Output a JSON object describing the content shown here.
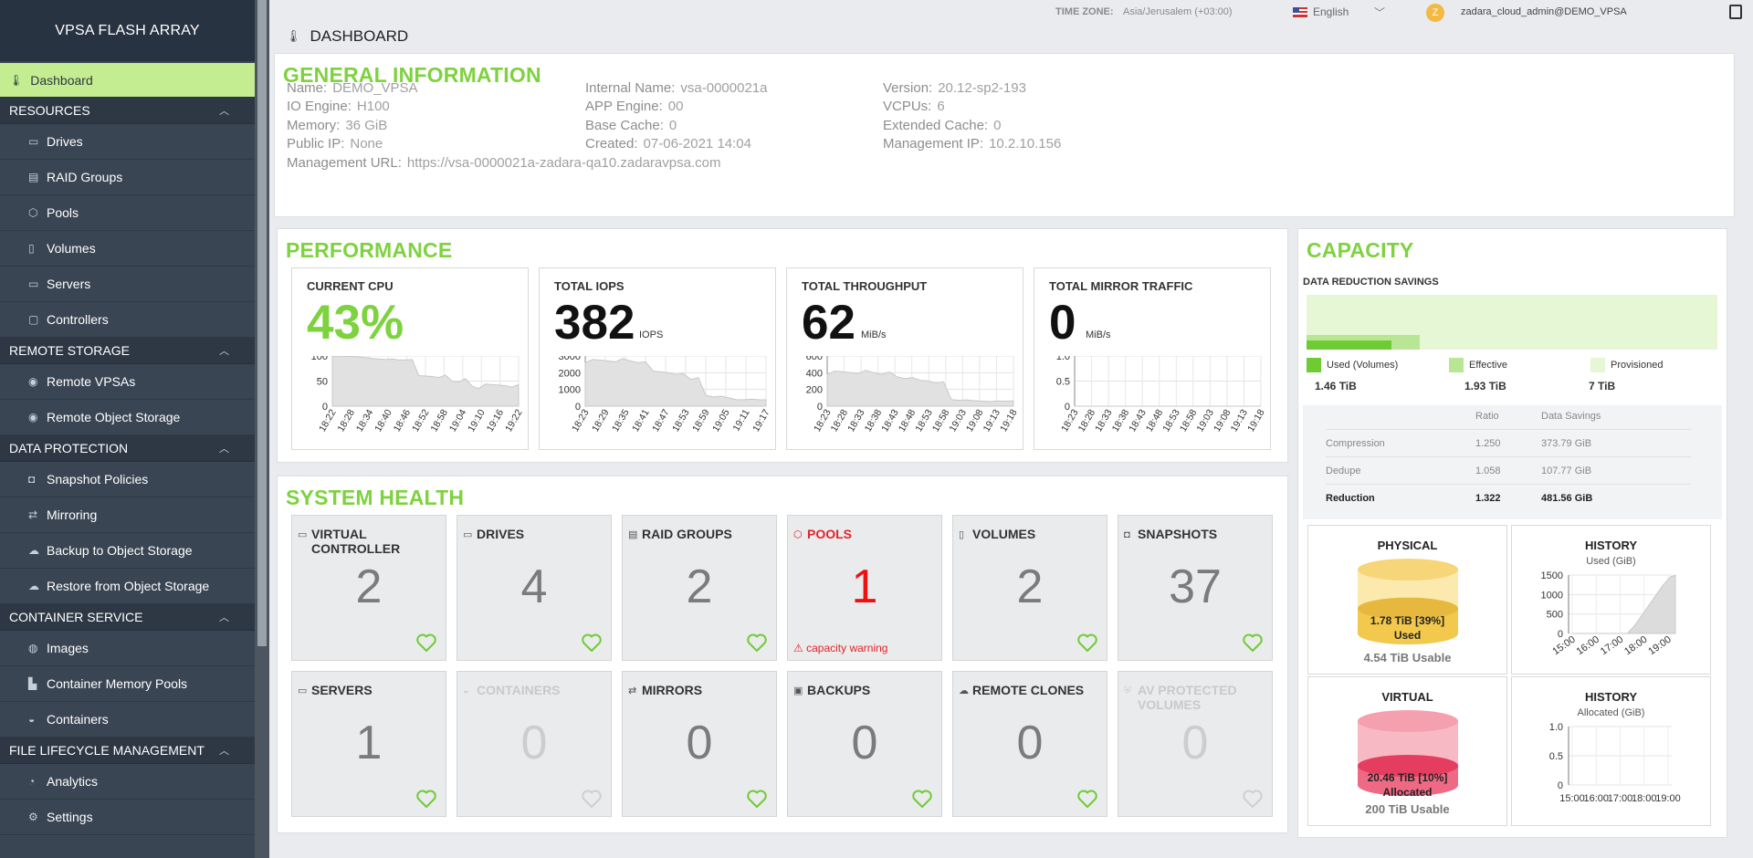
{
  "sidebar": {
    "title": "VPSA FLASH ARRAY",
    "dashboard": "Dashboard",
    "sections": [
      {
        "title": "RESOURCES",
        "items": [
          "Drives",
          "RAID Groups",
          "Pools",
          "Volumes",
          "Servers",
          "Controllers"
        ]
      },
      {
        "title": "REMOTE STORAGE",
        "items": [
          "Remote VPSAs",
          "Remote Object Storage"
        ]
      },
      {
        "title": "DATA PROTECTION",
        "items": [
          "Snapshot Policies",
          "Mirroring",
          "Backup to Object Storage",
          "Restore from Object Storage"
        ]
      },
      {
        "title": "CONTAINER SERVICE",
        "items": [
          "Images",
          "Container Memory Pools",
          "Containers"
        ]
      },
      {
        "title": "FILE LIFECYCLE MANAGEMENT",
        "items": [
          "Analytics",
          "Settings"
        ]
      }
    ]
  },
  "header": {
    "tz_label": "TIME ZONE:",
    "tz_value": "Asia/Jerusalem (+03:00)",
    "language": "English",
    "avatar_letter": "Z",
    "user": "zadara_cloud_admin@DEMO_VPSA",
    "page_title": "DASHBOARD"
  },
  "general": {
    "title": "GENERAL INFORMATION",
    "fields": [
      {
        "k": "Name:",
        "v": "DEMO_VPSA"
      },
      {
        "k": "Internal Name:",
        "v": "vsa-0000021a"
      },
      {
        "k": "Version:",
        "v": "20.12-sp2-193"
      },
      {
        "k": "IO Engine:",
        "v": "H100"
      },
      {
        "k": "APP Engine:",
        "v": "00"
      },
      {
        "k": "VCPUs:",
        "v": "6"
      },
      {
        "k": "Memory:",
        "v": "36 GiB"
      },
      {
        "k": "Base Cache:",
        "v": "0"
      },
      {
        "k": "Extended Cache:",
        "v": "0"
      },
      {
        "k": "Public IP:",
        "v": "None"
      },
      {
        "k": "Created:",
        "v": "07-06-2021 14:04"
      },
      {
        "k": "Management IP:",
        "v": "10.2.10.156"
      },
      {
        "k": "Management URL:",
        "v": "https://vsa-0000021a-zadara-qa10.zadaravpsa.com"
      }
    ]
  },
  "performance": {
    "title": "PERFORMANCE",
    "cards": [
      {
        "label": "CURRENT CPU",
        "value": "43%",
        "unit": "",
        "yticks": [
          "100",
          "50",
          "0"
        ],
        "ymax": 100,
        "xticks": [
          "18:22",
          "18:28",
          "18:34",
          "18:40",
          "18:46",
          "18:52",
          "18:58",
          "19:04",
          "19:10",
          "19:16",
          "19:22"
        ],
        "series": [
          99,
          100,
          99,
          99,
          98,
          97,
          95,
          94,
          93,
          94,
          92,
          92,
          93,
          61,
          60,
          59,
          57,
          62,
          50,
          48,
          55,
          40,
          35,
          44,
          43,
          42,
          41,
          38,
          43
        ]
      },
      {
        "label": "TOTAL IOPS",
        "value": "382",
        "unit": "IOPS",
        "yticks": [
          "3000",
          "2000",
          "1000",
          "0"
        ],
        "ymax": 3000,
        "xticks": [
          "18:23",
          "18:29",
          "18:35",
          "18:41",
          "18:47",
          "18:53",
          "18:59",
          "19:05",
          "19:11",
          "19:17"
        ],
        "series": [
          2600,
          2800,
          2750,
          2700,
          2650,
          2850,
          2700,
          2600,
          2650,
          2100,
          2050,
          2000,
          1900,
          1950,
          1600,
          1700,
          650,
          550,
          600,
          500,
          400,
          380,
          420,
          390,
          382
        ]
      },
      {
        "label": "TOTAL THROUGHPUT",
        "value": "62",
        "unit": "MiB/s",
        "yticks": [
          "600",
          "400",
          "200",
          "0"
        ],
        "ymax": 600,
        "xticks": [
          "18:23",
          "18:28",
          "18:33",
          "18:38",
          "18:43",
          "18:48",
          "18:53",
          "18:58",
          "19:03",
          "19:08",
          "19:13",
          "19:18"
        ],
        "series": [
          380,
          420,
          410,
          400,
          390,
          430,
          400,
          380,
          410,
          350,
          330,
          340,
          310,
          300,
          280,
          290,
          80,
          70,
          75,
          65,
          60,
          55,
          62,
          60,
          62
        ]
      },
      {
        "label": "TOTAL MIRROR TRAFFIC",
        "value": "0",
        "unit": "MiB/s",
        "yticks": [
          "1.0",
          "0.5",
          "0"
        ],
        "ymax": 1,
        "xticks": [
          "18:23",
          "18:28",
          "18:33",
          "18:38",
          "18:43",
          "18:48",
          "18:53",
          "18:58",
          "19:03",
          "19:08",
          "19:13",
          "19:18"
        ],
        "series": [
          0,
          0,
          0,
          0,
          0,
          0,
          0,
          0,
          0,
          0
        ]
      }
    ]
  },
  "health": {
    "title": "SYSTEM HEALTH",
    "tiles": [
      {
        "label": "VIRTUAL CONTROLLER",
        "value": "2",
        "icon": "monitor-icon",
        "glyph": "▭",
        "state": "ok"
      },
      {
        "label": "DRIVES",
        "value": "4",
        "icon": "drive-icon",
        "glyph": "▭",
        "state": "ok"
      },
      {
        "label": "RAID GROUPS",
        "value": "2",
        "icon": "raid-icon",
        "glyph": "▤",
        "state": "ok"
      },
      {
        "label": "POOLS",
        "value": "1",
        "icon": "pool-icon",
        "glyph": "⬡",
        "state": "warn",
        "warning": "capacity warning"
      },
      {
        "label": "VOLUMES",
        "value": "2",
        "icon": "volume-icon",
        "glyph": "▯",
        "state": "ok"
      },
      {
        "label": "SNAPSHOTS",
        "value": "37",
        "icon": "camera-icon",
        "glyph": "◘",
        "state": "ok"
      },
      {
        "label": "SERVERS",
        "value": "1",
        "icon": "server-icon",
        "glyph": "▭",
        "state": "ok"
      },
      {
        "label": "CONTAINERS",
        "value": "0",
        "icon": "container-icon",
        "glyph": "◒",
        "state": "dim"
      },
      {
        "label": "MIRRORS",
        "value": "0",
        "icon": "mirror-icon",
        "glyph": "⇄",
        "state": "ok"
      },
      {
        "label": "BACKUPS",
        "value": "0",
        "icon": "backup-icon",
        "glyph": "▣",
        "state": "ok"
      },
      {
        "label": "REMOTE CLONES",
        "value": "0",
        "icon": "cloud-icon",
        "glyph": "☁",
        "state": "ok"
      },
      {
        "label": "AV PROTECTED VOLUMES",
        "value": "0",
        "icon": "shield-icon",
        "glyph": "⛨",
        "state": "dim"
      }
    ]
  },
  "capacity": {
    "title": "CAPACITY",
    "drs_label": "DATA REDUCTION SAVINGS",
    "used_fraction": 0.207,
    "effective_fraction": 0.276,
    "legend": [
      {
        "label": "Used (Volumes)",
        "value": "1.46 TiB",
        "color": "#6fcb34"
      },
      {
        "label": "Effective",
        "value": "1.93 TiB",
        "color": "#b8e694"
      },
      {
        "label": "Provisioned",
        "value": "7 TiB",
        "color": "#e6f7d6"
      }
    ],
    "ratio_headers": [
      "Ratio",
      "Data Savings"
    ],
    "ratios": [
      {
        "name": "Compression",
        "ratio": "1.250",
        "savings": "373.79 GiB"
      },
      {
        "name": "Dedupe",
        "ratio": "1.058",
        "savings": "107.77 GiB"
      },
      {
        "name": "Reduction",
        "ratio": "1.322",
        "savings": "481.56 GiB"
      }
    ],
    "physical": {
      "title": "PHYSICAL",
      "line1": "1.78 TiB [39%]",
      "line2": "Used",
      "usable": "4.54 TiB Usable",
      "fill_fraction": 0.39
    },
    "physical_history": {
      "title": "HISTORY",
      "subtitle": "Used (GiB)",
      "yticks": [
        "1500",
        "1000",
        "500",
        "0"
      ],
      "ymax": 1500,
      "xticks": [
        "15:00",
        "16:00",
        "17:00",
        "18:00",
        "19:00"
      ],
      "series": [
        [
          0,
          0
        ],
        [
          1,
          0
        ],
        [
          2,
          0
        ],
        [
          2.3,
          0
        ],
        [
          2.6,
          200
        ],
        [
          3,
          550
        ],
        [
          3.4,
          900
        ],
        [
          3.8,
          1250
        ],
        [
          4.1,
          1450
        ],
        [
          4.3,
          1500
        ]
      ]
    },
    "virtual": {
      "title": "VIRTUAL",
      "line1": "20.46 TiB [10%]",
      "line2": "Allocated",
      "usable": "200 TiB Usable",
      "fill_fraction": 0.1
    },
    "virtual_history": {
      "title": "HISTORY",
      "subtitle": "Allocated (GiB)",
      "yticks": [
        "1.0",
        "0.5",
        "0"
      ],
      "ymax": 1,
      "xticks": [
        "15:00",
        "16:00",
        "17:00",
        "18:00",
        "19:00"
      ],
      "series": []
    }
  }
}
